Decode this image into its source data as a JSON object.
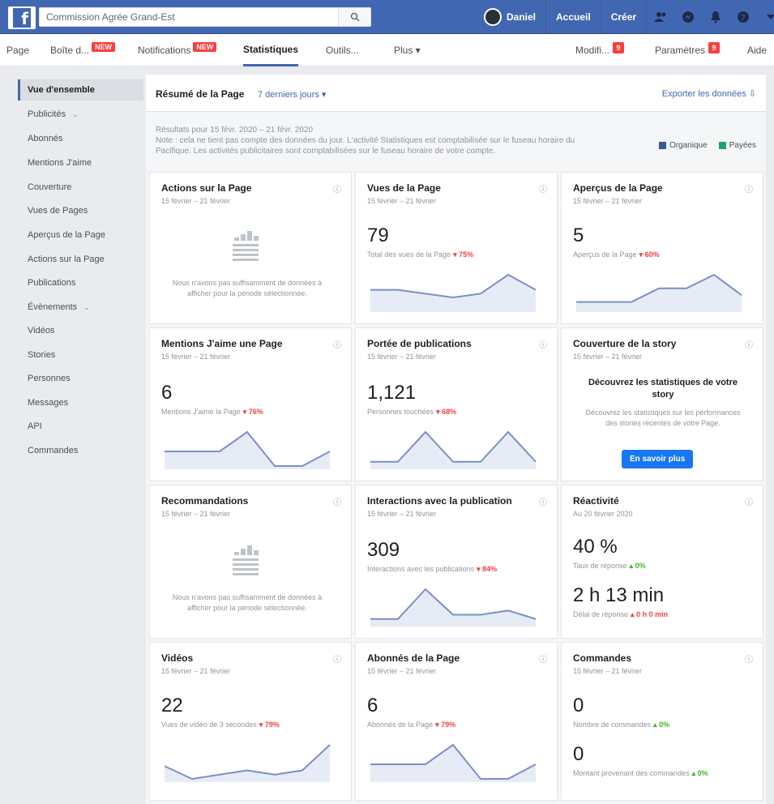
{
  "topbar": {
    "search_text": "Commission Agrée Grand-Est",
    "user_name": "Daniel",
    "links": [
      "Accueil",
      "Créer"
    ]
  },
  "page_tabs": {
    "page": "Page",
    "inbox": "Boîte d...",
    "inbox_badge": "NEW",
    "notifications": "Notifications",
    "notifications_badge": "NEW",
    "stats": "Statistiques",
    "tools": "Outils...",
    "more": "Plus ▾",
    "edit": "Modifi...",
    "edit_badge": "9",
    "settings": "Paramètres",
    "settings_badge": "9",
    "help": "Aide"
  },
  "sidebar": {
    "items": [
      {
        "label": "Vue d'ensemble",
        "active": true
      },
      {
        "label": "Publicités",
        "chevron": true
      },
      {
        "label": "Abonnés"
      },
      {
        "label": "Mentions J'aime"
      },
      {
        "label": "Couverture"
      },
      {
        "label": "Vues de Pages"
      },
      {
        "label": "Aperçus de la Page"
      },
      {
        "label": "Actions sur la Page"
      },
      {
        "label": "Publications"
      },
      {
        "label": "Évènements",
        "chevron": true
      },
      {
        "label": "Vidéos"
      },
      {
        "label": "Stories"
      },
      {
        "label": "Personnes"
      },
      {
        "label": "Messages"
      },
      {
        "label": "API"
      },
      {
        "label": "Commandes"
      }
    ]
  },
  "summary": {
    "title": "Résumé de la Page",
    "range": "7 derniers jours ▾",
    "export": "Exporter les données",
    "note_line1": "Résultats pour 15 févr. 2020 – 21 févr. 2020",
    "note_line2": "Note : cela ne tient pas compte des données du jour. L'activité Statistiques est comptabilisée sur le fuseau horaire du Pacifique. Les activités publicitaires sont comptabilisées sur le fuseau horaire de votre compte.",
    "legend_organic": "Organique",
    "legend_paid": "Payées",
    "color_organic": "#3b5998",
    "color_paid": "#20a36b"
  },
  "cards": {
    "actions": {
      "title": "Actions sur la Page",
      "date": "15 février – 21 février",
      "empty": "Nous n'avons pas suffisamment de données à afficher pour la période sélectionnée."
    },
    "views": {
      "title": "Vues de la Page",
      "date": "15 février – 21 février",
      "value": "79",
      "metric": "Total des vues de la Page",
      "delta": "▾ 75%"
    },
    "previews": {
      "title": "Aperçus de la Page",
      "date": "15 février – 21 février",
      "value": "5",
      "metric": "Aperçus de la Page",
      "delta": "▾ 60%"
    },
    "likes": {
      "title": "Mentions J'aime une Page",
      "date": "15 février – 21 février",
      "value": "6",
      "metric": "Mentions J'aime la Page",
      "delta": "▾ 76%"
    },
    "reach": {
      "title": "Portée de publications",
      "date": "15 février – 21 février",
      "value": "1,121",
      "metric": "Personnes touchées",
      "delta": "▾ 68%"
    },
    "story": {
      "title": "Couverture de la story",
      "date": "15 février – 21 février",
      "headline": "Découvrez les statistiques de votre story",
      "body": "Découvrez les statistiques sur les performances des stories récentes de votre Page.",
      "cta": "En savoir plus"
    },
    "recommendations": {
      "title": "Recommandations",
      "date": "15 février – 21 février",
      "empty": "Nous n'avons pas suffisamment de données à afficher pour la période sélectionnée."
    },
    "engagement": {
      "title": "Interactions avec la publication",
      "date": "15 février – 21 février",
      "value": "309",
      "metric": "Interactions avec les publications",
      "delta": "▾ 84%"
    },
    "responsiveness": {
      "title": "Réactivité",
      "date": "Au 20 février 2020",
      "value1": "40 %",
      "metric1": "Taux de réponse",
      "delta1": "▴ 0%",
      "value2": "2 h 13 min",
      "metric2": "Délai de réponse",
      "delta2": "▴ 0 h 0 min"
    },
    "videos": {
      "title": "Vidéos",
      "date": "15 février – 21 février",
      "value": "22",
      "metric": "Vues de vidéo de 3 secondes",
      "delta": "▾ 79%"
    },
    "followers": {
      "title": "Abonnés de la Page",
      "date": "15 février – 21 février",
      "value": "6",
      "metric": "Abonnés de la Page",
      "delta": "▾ 79%"
    },
    "orders": {
      "title": "Commandes",
      "date": "15 février – 21 février",
      "value1": "0",
      "metric1": "Nombre de commandes",
      "delta1": "▴ 0%",
      "value2": "0",
      "metric2": "Montant provenant des commandes",
      "delta2": "▴ 0%"
    }
  },
  "sparklines": {
    "views": [
      5,
      5,
      4,
      3,
      4,
      9,
      5
    ],
    "previews": [
      1,
      1,
      1,
      3,
      3,
      5,
      2
    ],
    "likes": [
      3,
      3,
      3,
      7,
      0,
      0,
      3
    ],
    "reach": [
      1,
      1,
      8,
      1,
      1,
      8,
      1
    ],
    "engagement": [
      1,
      1,
      8,
      2,
      2,
      3,
      1
    ],
    "videos": [
      3,
      0,
      1,
      2,
      1,
      2,
      8
    ],
    "followers": [
      3,
      3,
      3,
      7,
      0,
      0,
      3
    ]
  }
}
